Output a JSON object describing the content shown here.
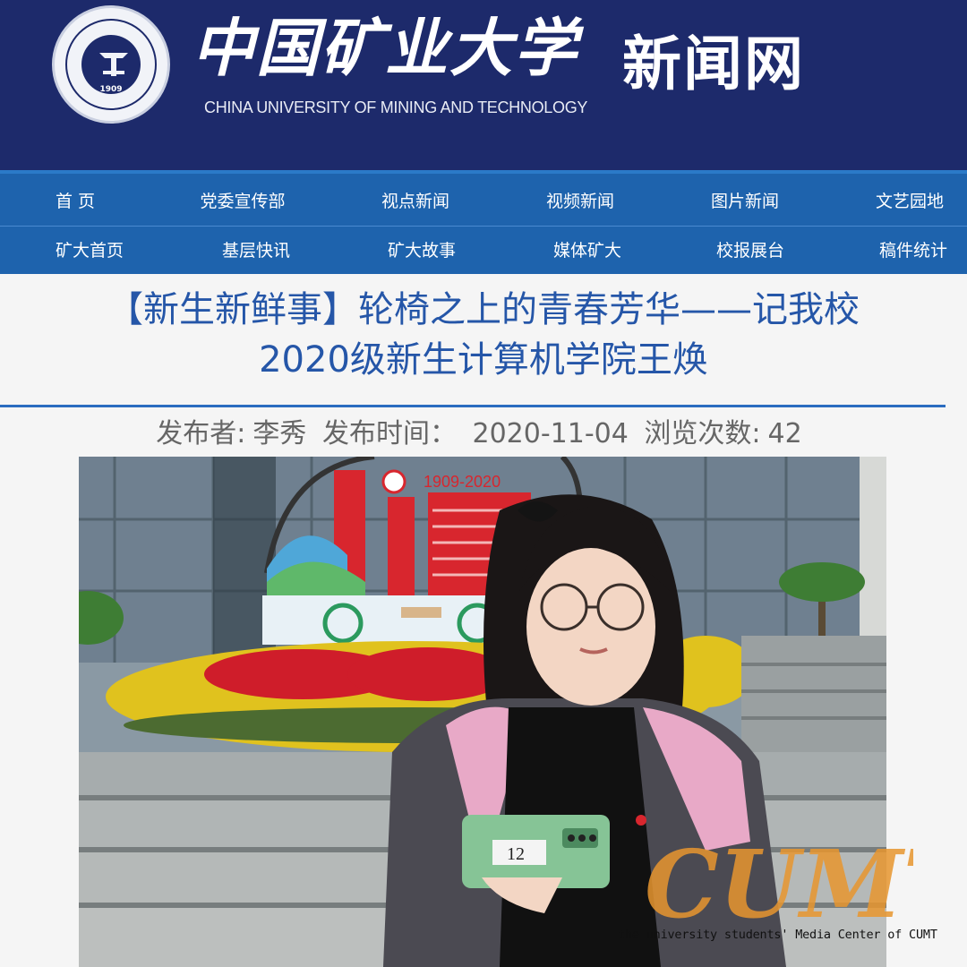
{
  "header": {
    "university_name_cn": "中国矿业大学",
    "university_name_en": "CHINA UNIVERSITY OF MINING AND TECHNOLOGY",
    "seal_year": "1909",
    "site_name": "新闻网",
    "colors": {
      "banner": "#1d2a6b",
      "nav": "#1e63ad",
      "title": "#2556a8"
    }
  },
  "nav": {
    "row1": [
      "首 页",
      "党委宣传部",
      "视点新闻",
      "视频新闻",
      "图片新闻",
      "文艺园地"
    ],
    "row2": [
      "矿大首页",
      "基层快讯",
      "矿大故事",
      "媒体矿大",
      "校报展台",
      "稿件统计"
    ]
  },
  "article": {
    "title_line1": "【新生新鲜事】轮椅之上的青春芳华——记我校",
    "title_line2": "2020级新生计算机学院王焕",
    "publisher_label": "发布者:",
    "publisher": "李秀",
    "time_label": "发布时间：",
    "date": "2020-11-04",
    "views_label": "浏览次数:",
    "views": "42"
  },
  "photo": {
    "sign_text": "1909-2020",
    "phone_tag": "12"
  },
  "watermark": {
    "logo_text": "CUMT",
    "caption": "the university students' Media  Center of CUMT"
  }
}
